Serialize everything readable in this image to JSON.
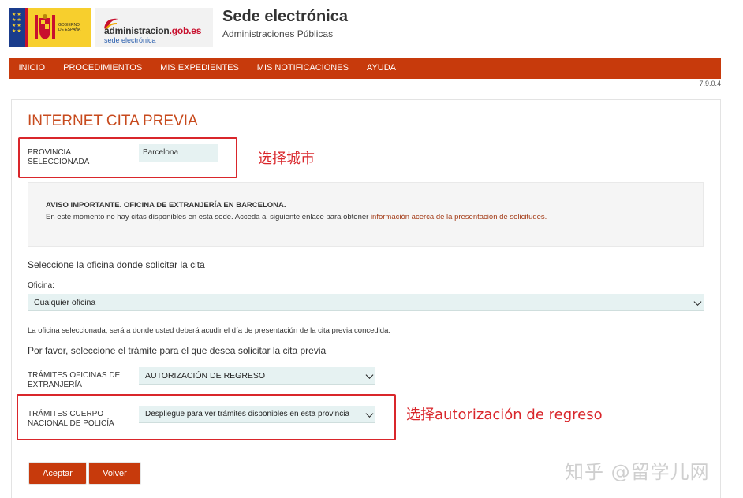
{
  "logos": {
    "gobierno": {
      "line1": "GOBIERNO",
      "line2": "DE ESPAÑA"
    },
    "admin": {
      "domain_main": "administracion",
      "domain_tld": ".gob.es",
      "sub": "sede electrónica"
    }
  },
  "header": {
    "title": "Sede electrónica",
    "subtitle": "Administraciones Públicas"
  },
  "nav": {
    "items": [
      "INICIO",
      "PROCEDIMIENTOS",
      "MIS EXPEDIENTES",
      "MIS NOTIFICACIONES",
      "AYUDA"
    ]
  },
  "version": "7.9.0.4",
  "page": {
    "title": "INTERNET CITA PREVIA"
  },
  "provincia": {
    "label_line1": "PROVINCIA",
    "label_line2": "SELECCIONADA",
    "value": "Barcelona"
  },
  "annotations": {
    "city": "选择城市",
    "tramite": "选择autorización de regreso"
  },
  "notice": {
    "title": "AVISO IMPORTANTE. OFICINA DE EXTRANJERÍA EN BARCELONA.",
    "text": "En este momento no hay citas disponibles en esta sede. Acceda al siguiente enlace para obtener ",
    "link": "información acerca de la presentación de solicitudes."
  },
  "oficina": {
    "prompt": "Seleccione la oficina donde solicitar la cita",
    "label": "Oficina:",
    "selected": "Cualquier oficina",
    "help": "La oficina seleccionada, será a donde usted deberá acudir el día de presentación de la cita previa concedida."
  },
  "tramite": {
    "prompt": "Por favor, seleccione el trámite para el que desea solicitar la cita previa",
    "extranjeria": {
      "label_line1": "TRÁMITES OFICINAS DE",
      "label_line2": "EXTRANJERÍA",
      "selected": "AUTORIZACIÓN DE REGRESO"
    },
    "policia": {
      "label_line1": "TRÁMITES CUERPO",
      "label_line2": "NACIONAL DE POLICÍA",
      "selected": "Despliegue para ver trámites disponibles en esta provincia"
    }
  },
  "buttons": {
    "accept": "Aceptar",
    "back": "Volver"
  },
  "watermark": "知乎 @留学儿网",
  "colors": {
    "brand": "#c73a0c",
    "annotation": "#d9262b",
    "select_bg": "#e6f2f2"
  }
}
